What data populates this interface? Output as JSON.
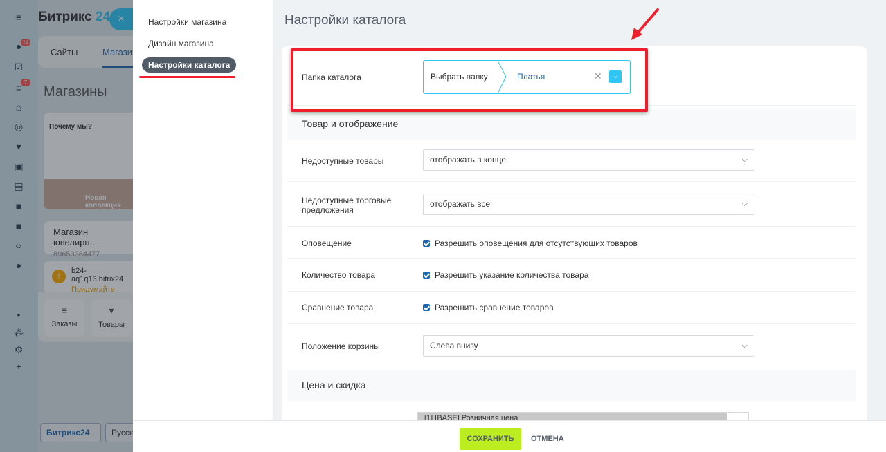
{
  "background": {
    "logo_main": "Битрикс",
    "logo_num": "24",
    "close_glyph": "×",
    "badges": {
      "b1": "14",
      "b2": "7"
    },
    "tabs": {
      "sites": "Сайты",
      "shops": "Магазины"
    },
    "page_title": "Магазины",
    "card": {
      "heading": "Почему мы?",
      "banner": "Новая коллекция"
    },
    "store": {
      "name": "Магазин ювелирн...",
      "phone": "89653384477"
    },
    "warning": {
      "domain": "b24-aq1q13.bitrix24",
      "hint": "Придумайте красивый адрес"
    },
    "actions": {
      "orders": "Заказы",
      "goods": "Товары"
    },
    "bottom": {
      "brand": "Битрикс24",
      "lang": "Русский"
    }
  },
  "menu": {
    "items": [
      "Настройки магазина",
      "Дизайн магазина",
      "Настройки каталога"
    ]
  },
  "header": {
    "title": "Настройки каталога"
  },
  "catalog_folder": {
    "label": "Папка каталога",
    "choose": "Выбрать папку",
    "value": "Платья"
  },
  "sections": {
    "goods": "Товар и отображение",
    "price": "Цена и скидка"
  },
  "fields": {
    "unavailable": {
      "label": "Недоступные товары",
      "value": "отображать в конце"
    },
    "unavailable_offers": {
      "label": "Недоступные торговые предложения",
      "value": "отображать все"
    },
    "notify": {
      "label": "Оповещение",
      "check": "Разрешить оповещения для отсутствующих товаров"
    },
    "quantity": {
      "label": "Количество товара",
      "check": "Разрешить указание количества товара"
    },
    "compare": {
      "label": "Сравнение товара",
      "check": "Разрешить сравнение товаров"
    },
    "cart_position": {
      "label": "Положение корзины",
      "value": "Слева внизу"
    },
    "price_type": {
      "value": "[1] [BASE] Розничная цена"
    }
  },
  "footer": {
    "save": "СОХРАНИТЬ",
    "cancel": "ОТМЕНА"
  },
  "colors": {
    "accent": "#2fc6f6",
    "save": "#bbed21",
    "highlight": "#ee1f2d",
    "link": "#2067b0"
  }
}
